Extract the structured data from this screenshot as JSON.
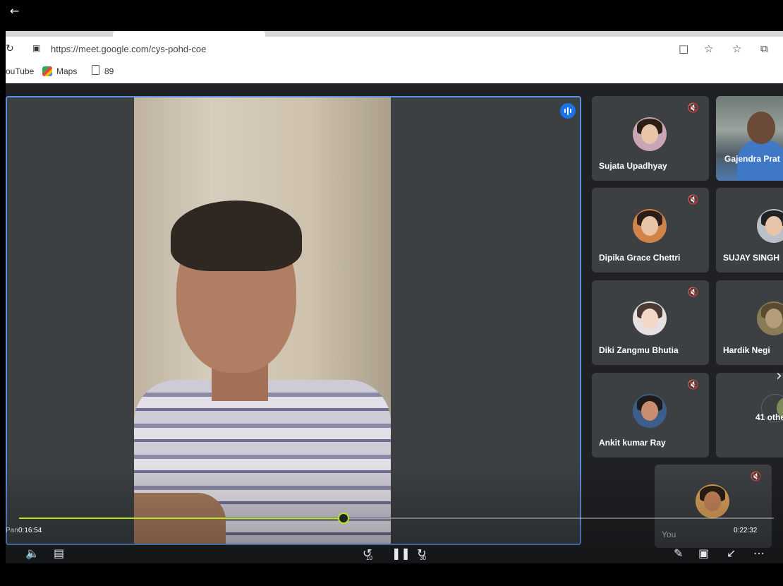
{
  "browser": {
    "url": "https://meet.google.com/cys-pohd-coe",
    "bookmarks": [
      "ouTube",
      "Maps",
      "89"
    ]
  },
  "participants": [
    {
      "name": "Sujata Upadhyay",
      "muted": true
    },
    {
      "name": "Gajendra Prat",
      "muted": false
    },
    {
      "name": "Dipika Grace Chettri",
      "muted": true
    },
    {
      "name": "SUJAY SINGH",
      "muted": false
    },
    {
      "name": "Diki Zangmu Bhutia",
      "muted": true
    },
    {
      "name": "Hardik Negi",
      "muted": false
    },
    {
      "name": "Ankit kumar Ray",
      "muted": true
    },
    {
      "name": "41 othe",
      "muted": false
    }
  ],
  "self_tile": {
    "name": "You"
  },
  "main_speaker": {
    "name_partial": "Pan"
  },
  "player": {
    "current_time": "0:16:54",
    "total_time": "0:22:32",
    "progress": 0.43,
    "rewind_seconds": "10",
    "forward_seconds": "30"
  },
  "icons": {
    "back": "back-arrow-icon",
    "mute": "mic-off-icon",
    "speaking": "speaking-icon",
    "accent": "#b5e61d",
    "tile_border": "#5b8fe0"
  }
}
